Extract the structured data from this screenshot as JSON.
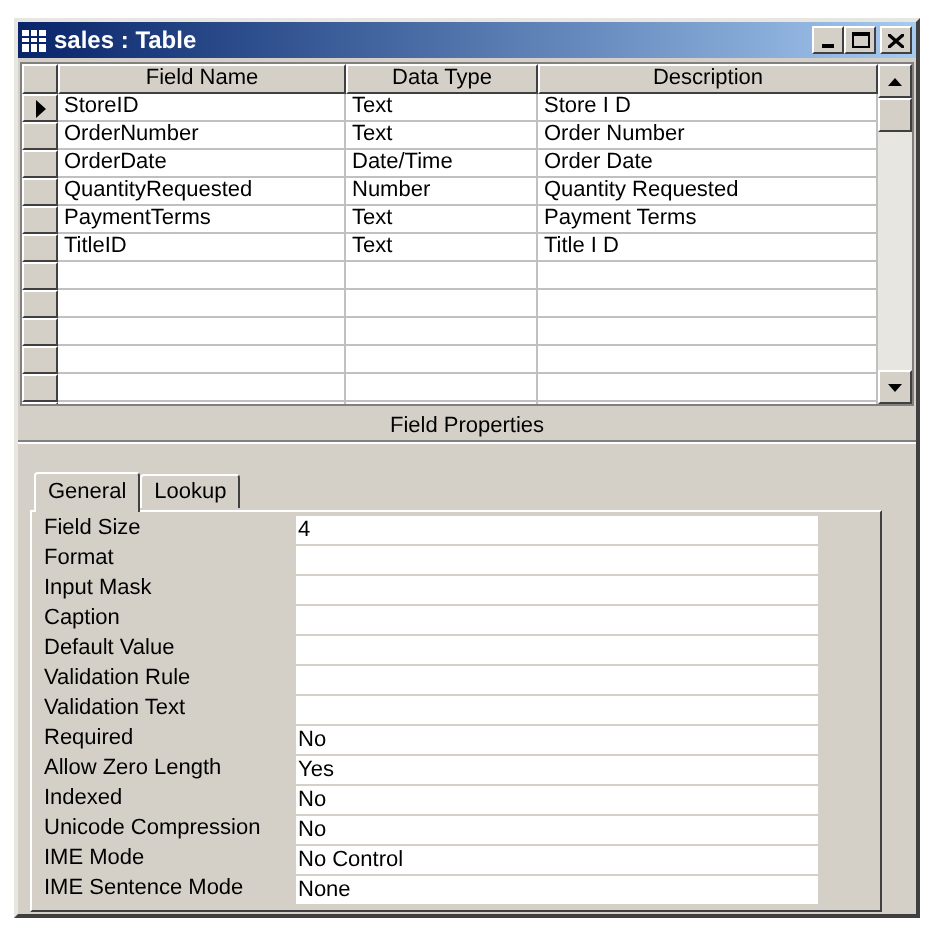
{
  "window": {
    "title": "sales : Table"
  },
  "grid": {
    "columns": [
      "Field Name",
      "Data Type",
      "Description"
    ],
    "rows": [
      {
        "field_name": "StoreID",
        "data_type": "Text",
        "description": "Store I D",
        "current": true
      },
      {
        "field_name": "OrderNumber",
        "data_type": "Text",
        "description": "Order Number",
        "current": false
      },
      {
        "field_name": "OrderDate",
        "data_type": "Date/Time",
        "description": "Order Date",
        "current": false
      },
      {
        "field_name": "QuantityRequested",
        "data_type": "Number",
        "description": "Quantity Requested",
        "current": false
      },
      {
        "field_name": "PaymentTerms",
        "data_type": "Text",
        "description": "Payment Terms",
        "current": false
      },
      {
        "field_name": "TitleID",
        "data_type": "Text",
        "description": "Title I D",
        "current": false
      }
    ]
  },
  "field_properties": {
    "title": "Field Properties",
    "tabs": [
      {
        "label": "General",
        "selected": true
      },
      {
        "label": "Lookup",
        "selected": false
      }
    ],
    "properties": [
      {
        "label": "Field Size",
        "value": "4"
      },
      {
        "label": "Format"
      },
      {
        "label": "Input Mask"
      },
      {
        "label": "Caption"
      },
      {
        "label": "Default Value"
      },
      {
        "label": "Validation Rule"
      },
      {
        "label": "Validation Text"
      },
      {
        "label": "Required",
        "value": "No"
      },
      {
        "label": "Allow Zero Length",
        "value": "Yes"
      },
      {
        "label": "Indexed",
        "value": "No"
      },
      {
        "label": "Unicode Compression",
        "value": "No"
      },
      {
        "label": "IME Mode",
        "value": "No Control"
      },
      {
        "label": "IME Sentence Mode",
        "value": "None"
      }
    ]
  }
}
